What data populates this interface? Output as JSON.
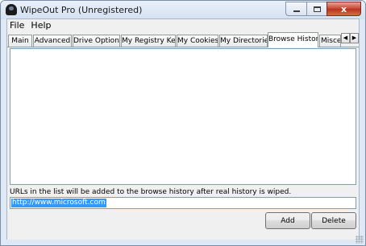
{
  "window": {
    "title": "WipeOut Pro (Unregistered)",
    "icon": "app-icon",
    "caption": {
      "minimize": "minimize-icon",
      "maximize": "maximize-icon",
      "close": "close-icon",
      "close_glyph": "x"
    }
  },
  "menubar": {
    "items": [
      "File",
      "Help"
    ]
  },
  "tabs": {
    "items": [
      "Main",
      "Advanced",
      "Drive Options",
      "My Registry Keys",
      "My Cookies",
      "My Directories",
      "Browse History",
      "Miscellaneous"
    ],
    "active": "Browse History",
    "scroll_left": "◀",
    "scroll_right": "▶"
  },
  "browse_history": {
    "list_items": [],
    "info_text": "URLs in the list will be added to the browse history after real history is wiped.",
    "url_value": "http://www.microsoft.com",
    "add_label": "Add",
    "delete_label": "Delete"
  },
  "colors": {
    "selection": "#3399ff",
    "close_button": "#c6432f"
  }
}
